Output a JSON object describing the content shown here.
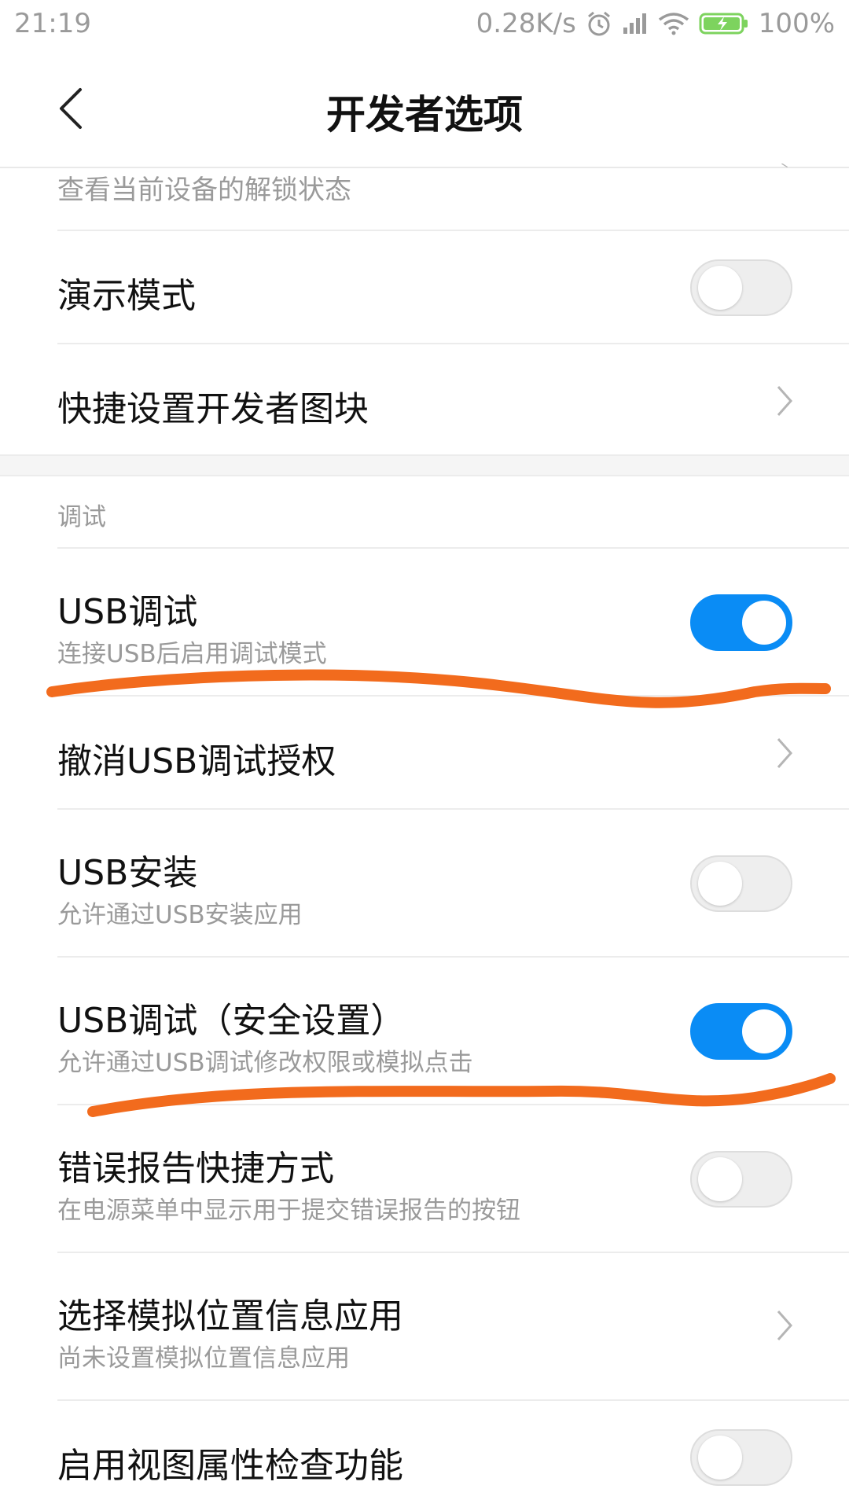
{
  "status_bar": {
    "time": "21:19",
    "net_speed": "0.28K/s",
    "battery": "100%"
  },
  "header": {
    "title": "开发者选项"
  },
  "partial_row": {
    "subtitle": "查看当前设备的解锁状态"
  },
  "section_debug_label": "调试",
  "items": [
    {
      "title": "演示模式",
      "subtitle": "",
      "control": "toggle",
      "on": false
    },
    {
      "title": "快捷设置开发者图块",
      "subtitle": "",
      "control": "chevron"
    },
    {
      "title": "USB调试",
      "subtitle": "连接USB后启用调试模式",
      "control": "toggle",
      "on": true
    },
    {
      "title": "撤消USB调试授权",
      "subtitle": "",
      "control": "chevron"
    },
    {
      "title": "USB安装",
      "subtitle": "允许通过USB安装应用",
      "control": "toggle",
      "on": false
    },
    {
      "title": "USB调试（安全设置）",
      "subtitle": "允许通过USB调试修改权限或模拟点击",
      "control": "toggle",
      "on": true
    },
    {
      "title": "错误报告快捷方式",
      "subtitle": "在电源菜单中显示用于提交错误报告的按钮",
      "control": "toggle",
      "on": false
    },
    {
      "title": "选择模拟位置信息应用",
      "subtitle": "尚未设置模拟位置信息应用",
      "control": "chevron"
    },
    {
      "title": "启用视图属性检查功能",
      "subtitle": "",
      "control": "toggle",
      "on": false
    }
  ],
  "colors": {
    "toggle_on": "#0a8cf5",
    "annotation": "#f26b1d"
  }
}
